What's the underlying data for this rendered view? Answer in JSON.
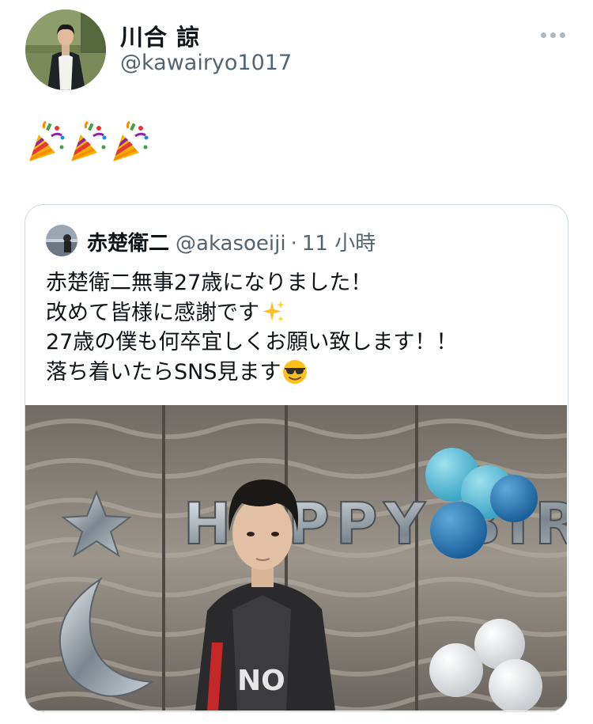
{
  "author": {
    "display_name": "川合 諒",
    "handle": "@kawairyo1017"
  },
  "tweet": {
    "emoji_icons": [
      "party-popper",
      "party-popper",
      "party-popper"
    ]
  },
  "quoted_tweet": {
    "display_name": "赤楚衛二",
    "handle": "@akasoeiji",
    "separator": "·",
    "time": "11 小時",
    "lines": [
      "赤楚衛二無事27歳になりました！",
      "改めて皆様に感謝です",
      "27歳の僕も何卒宜しくお願い致します！！",
      "落ち着いたらSNS見ます"
    ],
    "line_emoji_icons": [
      "sparkles",
      "smiling-face-with-sunglasses"
    ],
    "media": {
      "balloon_text": "HAPPY BIRTHDAY",
      "shirt_text": "NO"
    }
  },
  "colors": {
    "secondary_text": "#536471",
    "card_border": "#cfd9de",
    "more_dots": "#aab8c2"
  }
}
